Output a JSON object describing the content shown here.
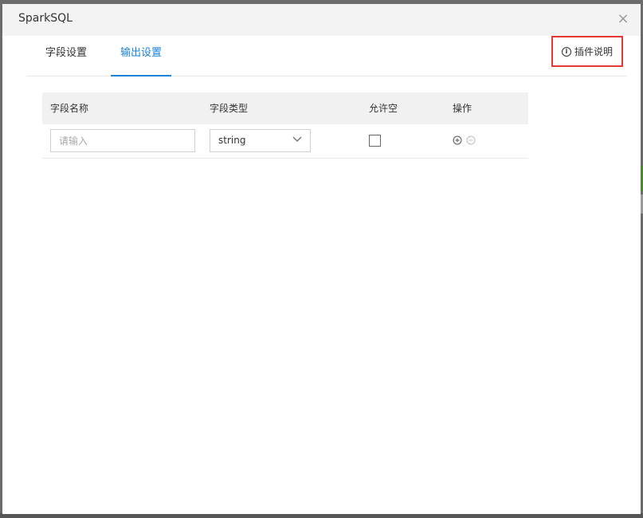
{
  "dialog": {
    "title": "SparkSQL",
    "close_glyph": "×"
  },
  "tabs": [
    {
      "label": "字段设置",
      "active": false
    },
    {
      "label": "输出设置",
      "active": true
    }
  ],
  "plugin_help": {
    "label": "插件说明",
    "icon": "info-icon",
    "icon_glyph": "i"
  },
  "table": {
    "columns": [
      "字段名称",
      "字段类型",
      "允许空",
      "操作"
    ],
    "rows": [
      {
        "name_value": "",
        "name_placeholder": "请输入",
        "type_value": "string",
        "allow_null": false,
        "actions": [
          "plus-circle-icon",
          "minus-circle-icon"
        ]
      }
    ]
  },
  "colors": {
    "accent": "#1a82d9",
    "highlight_border": "#e53935",
    "header_bg": "#f3f3f3",
    "table_header_bg": "#f1f1f1"
  }
}
